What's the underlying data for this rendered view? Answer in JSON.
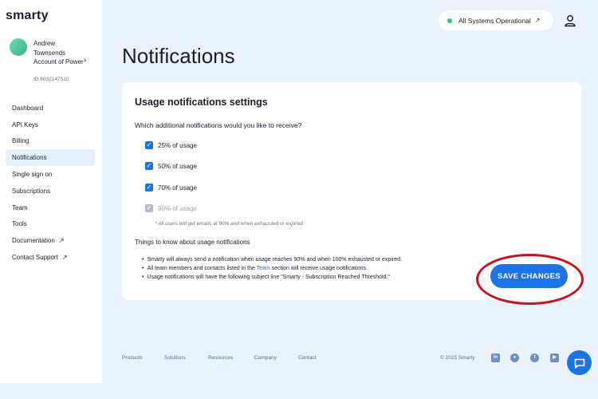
{
  "app": {
    "logo": "smarty"
  },
  "account": {
    "name": "Andrew Townsends Account of Power",
    "id": "ID 6032147510"
  },
  "sidebar": {
    "items": [
      {
        "label": "Dashboard"
      },
      {
        "label": "API Keys"
      },
      {
        "label": "Billing"
      },
      {
        "label": "Notifications",
        "active": true
      },
      {
        "label": "Single sign on"
      },
      {
        "label": "Subscriptions"
      },
      {
        "label": "Team"
      },
      {
        "label": "Tools"
      },
      {
        "label": "Documentation",
        "icon": "external-link-icon"
      },
      {
        "label": "Contact Support",
        "icon": "external-link-icon"
      }
    ]
  },
  "header": {
    "status": "All Systems Operational",
    "status_color": "#2ecc71",
    "user_icon": "user-icon"
  },
  "page": {
    "title": "Notifications"
  },
  "settings": {
    "title": "Usage notifications settings",
    "question": "Which additional notifications would you like to receive?",
    "options": [
      {
        "label": "25% of usage",
        "checked": true,
        "disabled": false
      },
      {
        "label": "50% of usage",
        "checked": true,
        "disabled": false
      },
      {
        "label": "70% of usage",
        "checked": true,
        "disabled": false
      },
      {
        "label": "90% of usage",
        "checked": true,
        "disabled": true
      }
    ],
    "note": "* All users will get emails at 90% and when exhausted or expired",
    "things_title": "Things to know about usage notifications",
    "bullet1": "Smarty will always send a notification when usage reaches 90% and when 100% exhausted or expired.",
    "bullet2_pre": "All team members and contacts listed in the ",
    "bullet2_link": "Team",
    "bullet2_post": " section will receive usage notifications.",
    "bullet3": "Usage notifications will have the following subject line \"Smarty - Subscription Reached Threshold.\"",
    "save_label": "SAVE CHANGES"
  },
  "footer": {
    "links": [
      "Products",
      "Solutions",
      "Resources",
      "Company",
      "Contact"
    ],
    "copyright": "© 2025 Smarty",
    "social": [
      "linkedin-icon",
      "github-icon",
      "facebook-icon",
      "youtube-icon"
    ]
  },
  "colors": {
    "accent": "#1a73e8",
    "highlight": "#d10f1c",
    "background": "#eaf3fc"
  }
}
